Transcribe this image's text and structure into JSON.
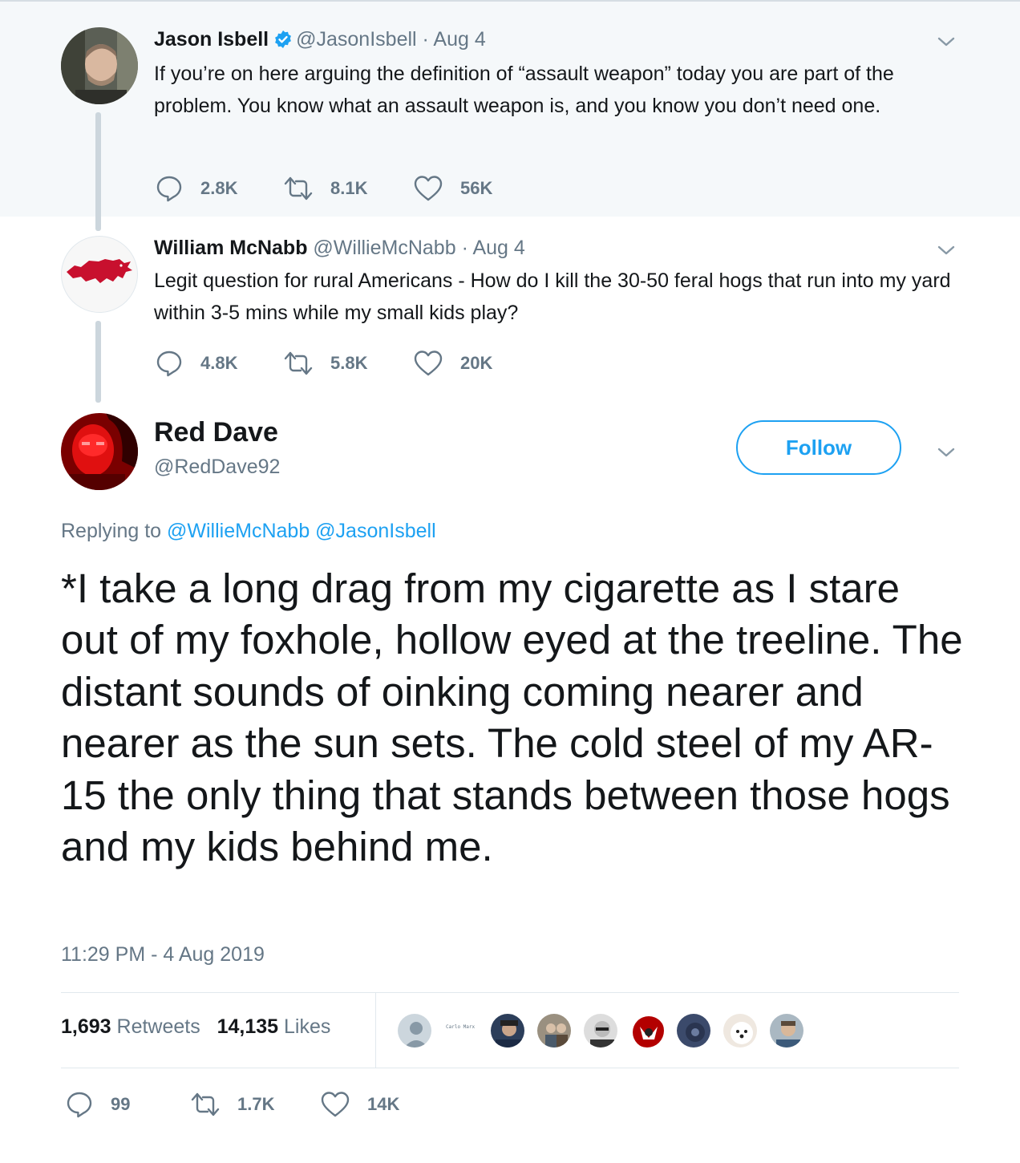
{
  "thread": [
    {
      "name": "Jason Isbell",
      "verified": true,
      "handle": "@JasonIsbell",
      "date": "· Aug 4",
      "text": "If you’re on here arguing the definition of “assault weapon” today you are part of the problem. You know what an assault weapon is, and you know you don’t need one.",
      "replies": "2.8K",
      "retweets": "8.1K",
      "likes": "56K"
    },
    {
      "name": "William McNabb",
      "verified": false,
      "handle": "@WillieMcNabb",
      "date": "· Aug 4",
      "text": "Legit question for rural Americans - How do I kill the 30-50 feral hogs that run into my yard within 3-5 mins while my small kids play?",
      "replies": "4.8K",
      "retweets": "5.8K",
      "likes": "20K"
    }
  ],
  "main_tweet": {
    "name": "Red Dave",
    "handle": "@RedDave92",
    "follow_label": "Follow",
    "replying_prefix": "Replying to",
    "replying_to": [
      "@WillieMcNabb",
      "@JasonIsbell"
    ],
    "text": "*I take a long drag from my cigarette as I stare out of my foxhole, hollow eyed at the treeline. The distant sounds of oinking coming nearer and nearer as the sun sets. The cold steel of my AR-15 the only thing that stands between those hogs and my kids behind me.",
    "timestamp": "11:29 PM - 4 Aug 2019",
    "retweet_count": "1,693",
    "retweet_label": "Retweets",
    "like_count": "14,135",
    "like_label": "Likes",
    "liker_caption": "Carlo Marx",
    "replies": "99",
    "retweets": "1.7K",
    "likes": "14K"
  },
  "colors": {
    "accent": "#1da1f2",
    "muted": "#657786",
    "thread_bg": "#f5f8fa",
    "razorback_red": "#c8102e"
  },
  "icons": [
    "verified-badge-icon",
    "chevron-down-icon",
    "reply-icon",
    "retweet-icon",
    "like-icon",
    "razorback-logo"
  ]
}
